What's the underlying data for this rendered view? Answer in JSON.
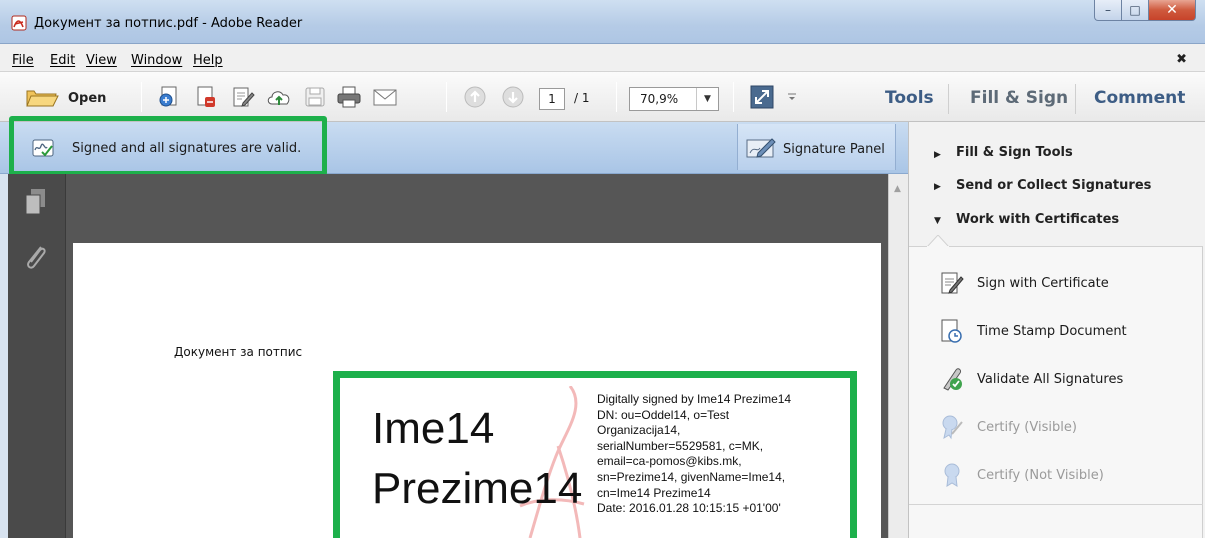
{
  "window": {
    "title": "Документ за потпис.pdf - Adobe Reader",
    "minimize_glyph": "–",
    "maximize_glyph": "□",
    "close_glyph": "✕"
  },
  "menu": {
    "items": [
      "File",
      "Edit",
      "View",
      "Window",
      "Help"
    ],
    "close_doc_glyph": "✖"
  },
  "toolbar": {
    "open_label": "Open",
    "page_current": "1",
    "page_total": "/ 1",
    "zoom": "70,9%",
    "tabs": {
      "tools": "Tools",
      "fill_sign": "Fill & Sign",
      "comment": "Comment"
    }
  },
  "signature_bar": {
    "message": "Signed and all signatures are valid.",
    "panel_button": "Signature Panel"
  },
  "document": {
    "heading": "Документ за потпис",
    "signature": {
      "first_name": "Ime14",
      "last_name": "Prezime14",
      "details": [
        "Digitally signed by Ime14 Prezime14",
        "DN: ou=Oddel14, o=Test",
        "Organizacija14,",
        "serialNumber=5529581, c=MK,",
        "email=ca-pomos@kibs.mk,",
        "sn=Prezime14, givenName=Ime14,",
        "cn=Ime14 Prezime14",
        "Date: 2016.01.28 10:15:15 +01'00'"
      ]
    }
  },
  "tools_pane": {
    "sections": [
      {
        "label": "Fill & Sign Tools",
        "expanded": false
      },
      {
        "label": "Send or Collect Signatures",
        "expanded": false
      },
      {
        "label": "Work with Certificates",
        "expanded": true
      }
    ],
    "items": [
      {
        "label": "Sign with Certificate",
        "icon": "sign-certificate-icon",
        "enabled": true
      },
      {
        "label": "Time Stamp Document",
        "icon": "time-stamp-icon",
        "enabled": true
      },
      {
        "label": "Validate All Signatures",
        "icon": "validate-signatures-icon",
        "enabled": true
      },
      {
        "label": "Certify (Visible)",
        "icon": "certify-visible-icon",
        "enabled": false
      },
      {
        "label": "Certify (Not Visible)",
        "icon": "certify-not-visible-icon",
        "enabled": false
      }
    ]
  },
  "colors": {
    "highlight": "#1db04b",
    "tab_text": "#3d5d85",
    "signature_bar": "#b9d0ec",
    "document_bg": "#565656"
  }
}
